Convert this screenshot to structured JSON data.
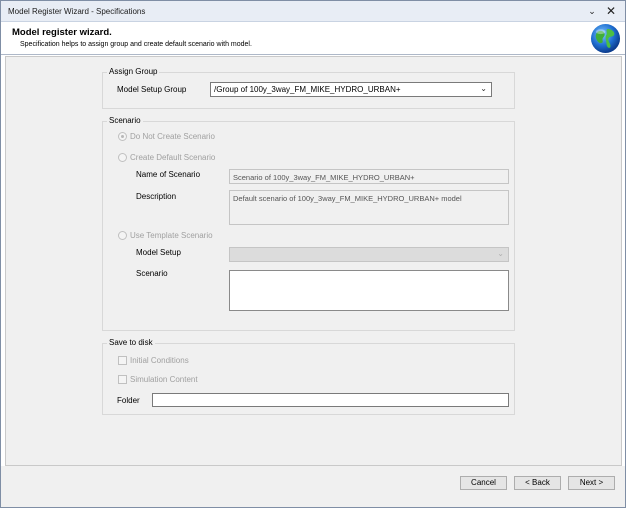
{
  "window": {
    "title": "Model Register Wizard - Specifications"
  },
  "header": {
    "title": "Model register wizard.",
    "subtitle": "Specification helps to assign group and create default scenario with model."
  },
  "assign_group": {
    "label": "Assign Group",
    "model_setup_group_label": "Model Setup Group",
    "model_setup_group_value": "/Group of 100y_3way_FM_MIKE_HYDRO_URBAN+"
  },
  "scenario": {
    "label": "Scenario",
    "do_not_create_label": "Do Not Create Scenario",
    "create_default_label": "Create Default Scenario",
    "name_label": "Name of Scenario",
    "name_value": "Scenario of 100y_3way_FM_MIKE_HYDRO_URBAN+",
    "description_label": "Description",
    "description_value": "Default scenario of 100y_3way_FM_MIKE_HYDRO_URBAN+ model",
    "use_template_label": "Use Template Scenario",
    "model_setup_label": "Model Setup",
    "scenario_label": "Scenario",
    "selected": "Do Not Create Scenario"
  },
  "save_to_disk": {
    "label": "Save to disk",
    "initial_conditions_label": "Initial Conditions",
    "simulation_content_label": "Simulation Content",
    "folder_label": "Folder",
    "folder_value": ""
  },
  "footer": {
    "cancel_label": "Cancel",
    "back_label": "< Back",
    "next_label": "Next >"
  },
  "icons": {
    "minimize": "chevron-down-icon",
    "close": "close-icon",
    "logo": "globe-icon"
  }
}
